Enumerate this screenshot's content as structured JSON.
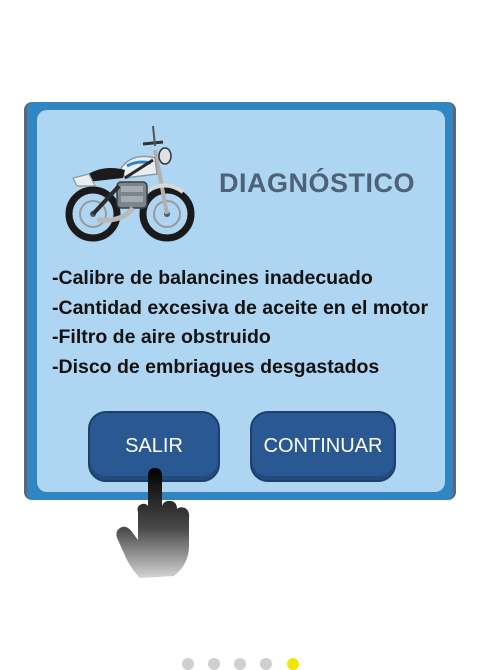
{
  "dialog": {
    "title": "DIAGNÓSTICO",
    "items": [
      "-Calibre de balancines inadecuado",
      "-Cantidad excesiva de aceite en el motor",
      "-Filtro de aire obstruido",
      "-Disco de embriagues desgastados"
    ],
    "exit_label": "SALIR",
    "continue_label": "CONTINUAR",
    "image_icon": "motorcycle-image"
  },
  "hint": {
    "icon": "pointing-hand-icon"
  },
  "pager": {
    "total_pages": 5,
    "current_page": 5,
    "active_color": "#f2e600",
    "inactive_color": "#cfcfcf"
  },
  "colors": {
    "frame": "#2f86c2",
    "panel": "#aed5f1",
    "title": "#4e6277",
    "button": "#2a5892"
  }
}
